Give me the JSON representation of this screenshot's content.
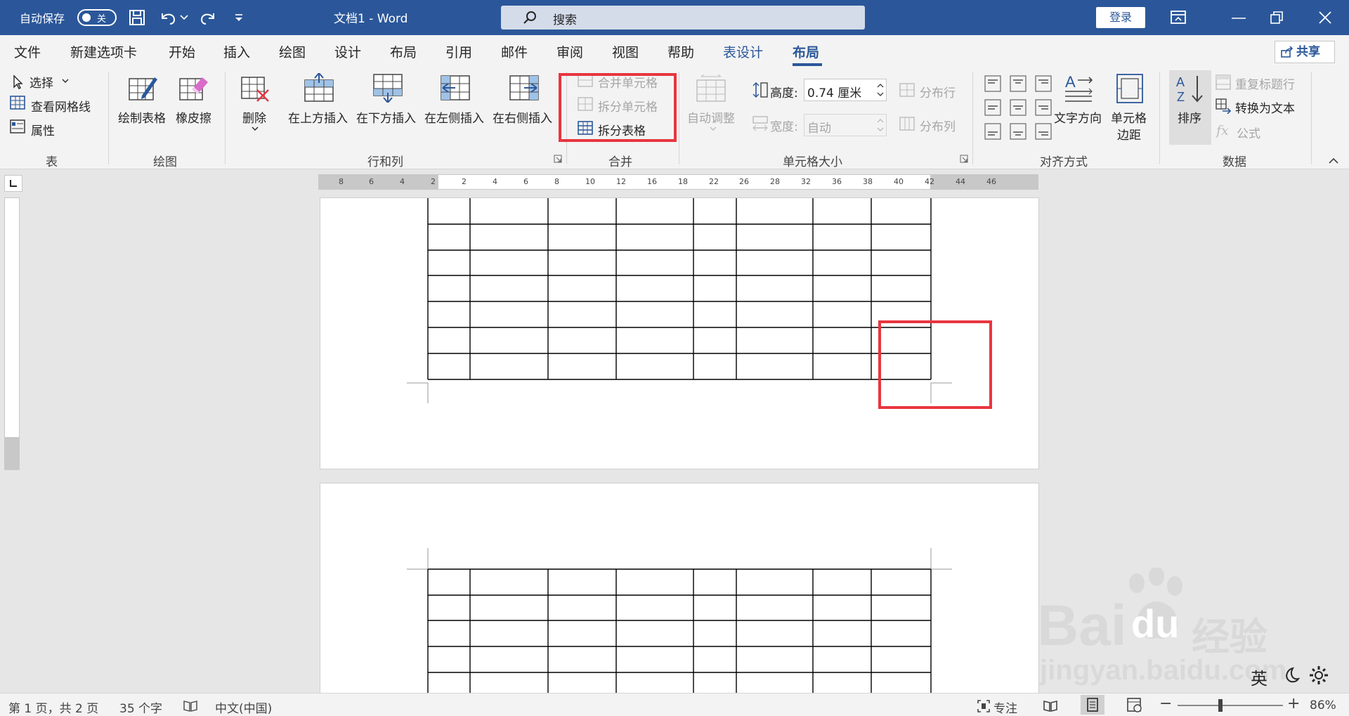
{
  "titlebar": {
    "autosave_label": "自动保存",
    "autosave_state": "关",
    "doc_title": "文档1  -  Word",
    "search_placeholder": "搜索",
    "login_label": "登录"
  },
  "tabs": [
    {
      "label": "文件"
    },
    {
      "label": "新建选项卡"
    },
    {
      "label": "开始"
    },
    {
      "label": "插入"
    },
    {
      "label": "绘图"
    },
    {
      "label": "设计"
    },
    {
      "label": "布局"
    },
    {
      "label": "引用"
    },
    {
      "label": "邮件"
    },
    {
      "label": "审阅"
    },
    {
      "label": "视图"
    },
    {
      "label": "帮助"
    },
    {
      "label": "表设计"
    },
    {
      "label": "布局"
    }
  ],
  "share_label": "共享",
  "ribbon": {
    "table": {
      "select": "选择",
      "gridlines": "查看网格线",
      "properties": "属性",
      "group": "表"
    },
    "draw": {
      "draw_table": "绘制表格",
      "eraser": "橡皮擦",
      "group": "绘图"
    },
    "rows_cols": {
      "delete": "删除",
      "insert_above": "在上方插入",
      "insert_below": "在下方插入",
      "insert_left": "在左侧插入",
      "insert_right": "在右侧插入",
      "group": "行和列"
    },
    "merge": {
      "merge_cells": "合并单元格",
      "split_cells": "拆分单元格",
      "split_table": "拆分表格",
      "group": "合并"
    },
    "cell_size": {
      "autofit": "自动调整",
      "height_label": "高度:",
      "height_value": "0.74 厘米",
      "width_label": "宽度:",
      "width_value": "自动",
      "dist_rows": "分布行",
      "dist_cols": "分布列",
      "group": "单元格大小"
    },
    "alignment": {
      "text_direction": "文字方向",
      "cell_margins_1": "单元格",
      "cell_margins_2": "边距",
      "group": "对齐方式"
    },
    "data": {
      "sort": "排序",
      "repeat_header": "重复标题行",
      "convert_text": "转换为文本",
      "formula": "公式",
      "group": "数据"
    }
  },
  "ruler_labels": [
    "8",
    "6",
    "4",
    "2",
    "2",
    "4",
    "6",
    "8",
    "10",
    "12",
    "16",
    "18",
    "22",
    "26",
    "28",
    "32",
    "36",
    "38",
    "40",
    "42",
    "44",
    "46"
  ],
  "status": {
    "page": "第 1 页，共 2 页",
    "words": "35 个字",
    "language": "中文(中国)",
    "focus": "专注",
    "zoom": "86%",
    "ime": "英"
  },
  "watermark": {
    "brand": "Bai",
    "brand2": "du",
    "cn": "经验",
    "url": "jingyan.baidu.com"
  },
  "colors": {
    "accent": "#2b579a",
    "highlight": "#e8353f"
  }
}
